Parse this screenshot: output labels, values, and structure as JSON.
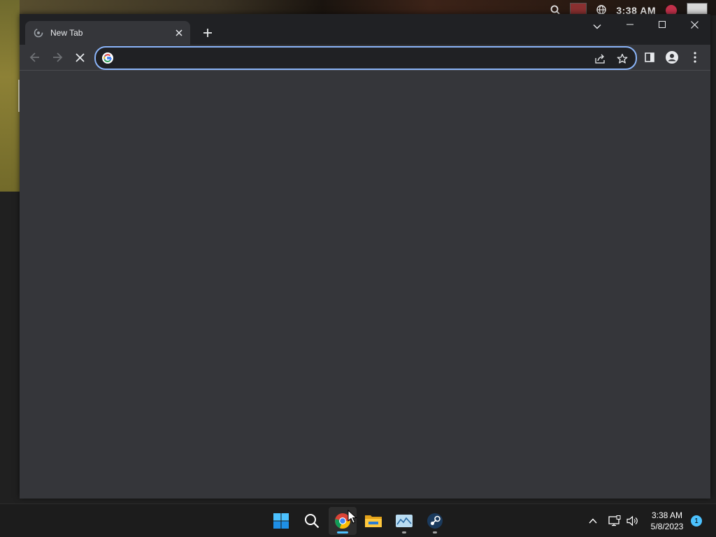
{
  "desktop": {
    "overlay_clock": "3:38 AM"
  },
  "browser": {
    "tab": {
      "title": "New Tab",
      "favicon": "loading-spinner-icon"
    },
    "new_tab_label": "+",
    "omnibox": {
      "value": "",
      "placeholder": ""
    },
    "accent_color": "#8ab4f8"
  },
  "taskbar": {
    "apps": [
      {
        "name": "Start",
        "icon": "windows-start-icon"
      },
      {
        "name": "Search",
        "icon": "search-icon"
      },
      {
        "name": "Google Chrome",
        "icon": "chrome-icon",
        "active": true
      },
      {
        "name": "File Explorer",
        "icon": "folder-icon"
      },
      {
        "name": "Photos",
        "icon": "photos-icon"
      },
      {
        "name": "Steam",
        "icon": "steam-icon"
      }
    ],
    "clock": {
      "time": "3:38 AM",
      "date": "5/8/2023"
    },
    "notification_count": "1"
  }
}
